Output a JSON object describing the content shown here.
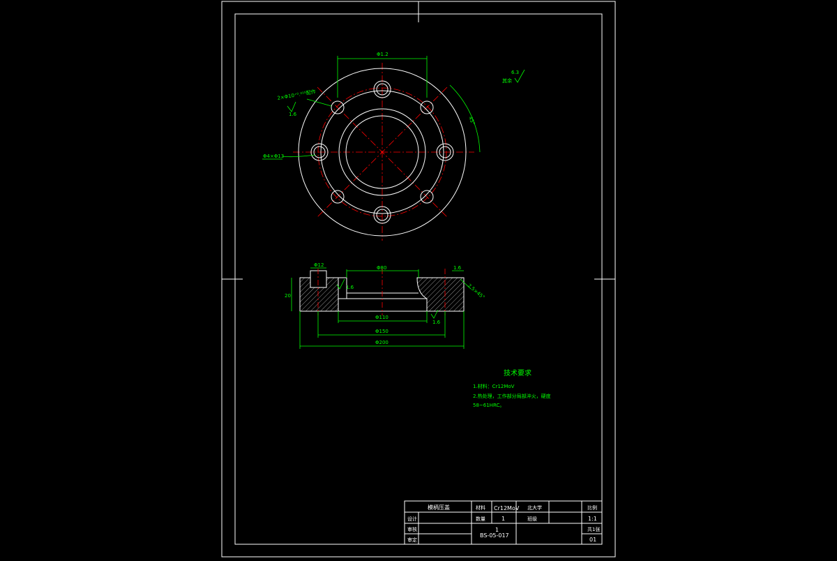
{
  "drawing": {
    "top_view": {
      "dim_width": "Φ1.2",
      "dim_small_holes": "2×Φ10⁺⁰.⁰¹⁵配作",
      "dim_small_holes_roughness": "1.6",
      "dim_bolt_holes": "Φ4×Φ13",
      "dim_angle": "45°",
      "roughness_other": "其余",
      "roughness_other_value": "6.3"
    },
    "section_view": {
      "dim_slot": "Φ12",
      "dim_bore": "Φ80",
      "dim_chamfer": "1.6",
      "dim_chamfer_angle": "2.5×45°",
      "dim_height": "20",
      "dim_roughness_a": "1.6",
      "dim_roughness_b": "1.6",
      "dim_d110": "Φ110",
      "dim_d150": "Φ150",
      "dim_d200": "Φ200"
    },
    "tech_requirements": {
      "title": "技术要求",
      "line1": "1.材料：Cr12MoV",
      "line2": "2.热处理，工作部分局部淬火，硬度",
      "line3": "58~61HRC。"
    },
    "title_block": {
      "part_name": "模柄压盖",
      "label_material": "材料",
      "material": "Cr12MoV",
      "label_org": "北大学",
      "label_scale": "比例",
      "scale": "1:1",
      "label_design": "设计",
      "label_quantity": "数量",
      "quantity": "1",
      "label_school": "班级",
      "label_check": "审核",
      "label_sheet": "共1张",
      "drawing_no": "BS-05-017",
      "drawing_no_top": "1",
      "label_approve": "审定",
      "sheet": "第1张",
      "sheet_right_label": "比例",
      "sheet_right_value": "01"
    }
  }
}
